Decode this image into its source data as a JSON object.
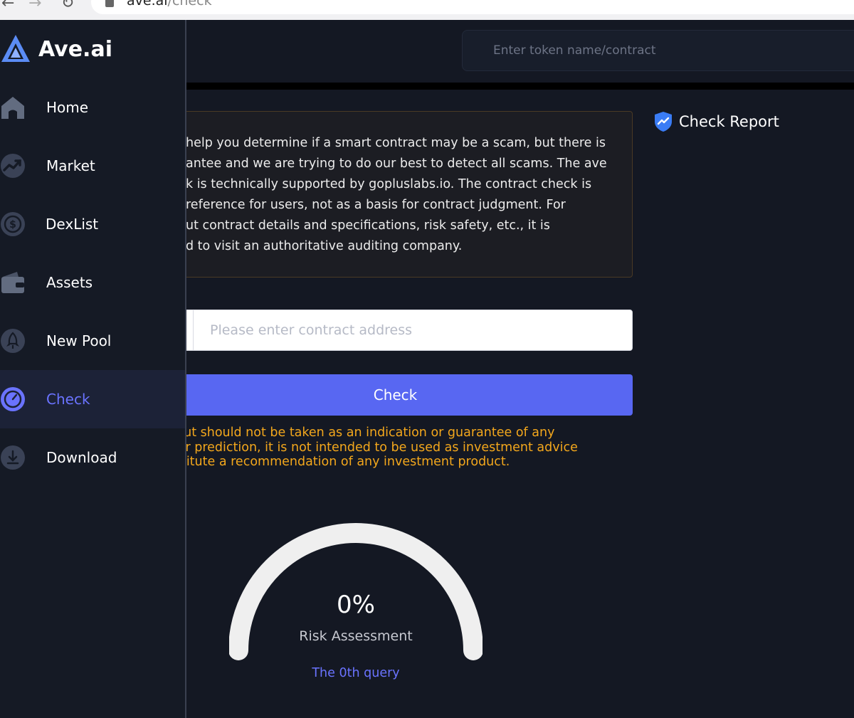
{
  "browser": {
    "url_host": "ave.ai",
    "url_path": "/check"
  },
  "sidebar": {
    "logo_text": "Ave.ai",
    "items": [
      {
        "label": "Home",
        "icon": "home-icon"
      },
      {
        "label": "Market",
        "icon": "market-icon"
      },
      {
        "label": "DexList",
        "icon": "dollar-icon"
      },
      {
        "label": "Assets",
        "icon": "wallet-icon"
      },
      {
        "label": "New Pool",
        "icon": "rocket-icon"
      },
      {
        "label": "Check",
        "icon": "check-gauge-icon",
        "active": true
      },
      {
        "label": "Download",
        "icon": "download-icon"
      }
    ]
  },
  "header": {
    "search_placeholder": "Enter token name/contract"
  },
  "notice": {
    "lines": [
      "help you determine if a smart contract may be a scam, but there is",
      "antee and we are trying to do our best to detect all scams. The ave",
      "k is technically supported by gopluslabs.io. The contract check is",
      "reference for users, not as a basis for contract judgment. For",
      "ut contract details and specifications, risk safety, etc., it is",
      "d to visit an authoritative auditing company."
    ]
  },
  "check_form": {
    "address_placeholder": "Please enter contract address",
    "button_label": "Check",
    "disclaimer_lines": [
      "e output should not be taken as an indication or guarantee of any",
      "ance or prediction, it is not intended to be used as investment advice",
      "t constitute a recommendation of any investment product."
    ]
  },
  "risk": {
    "value": "0%",
    "value_fraction": 0,
    "label": "Risk Assessment",
    "query_text": "The 0th query"
  },
  "report": {
    "title": "Check Report"
  },
  "colors": {
    "background": "#141823",
    "sidebar": "#151a25",
    "accent": "#5867f2",
    "active_text": "#6a73ff",
    "warning": "#f3a71c"
  }
}
